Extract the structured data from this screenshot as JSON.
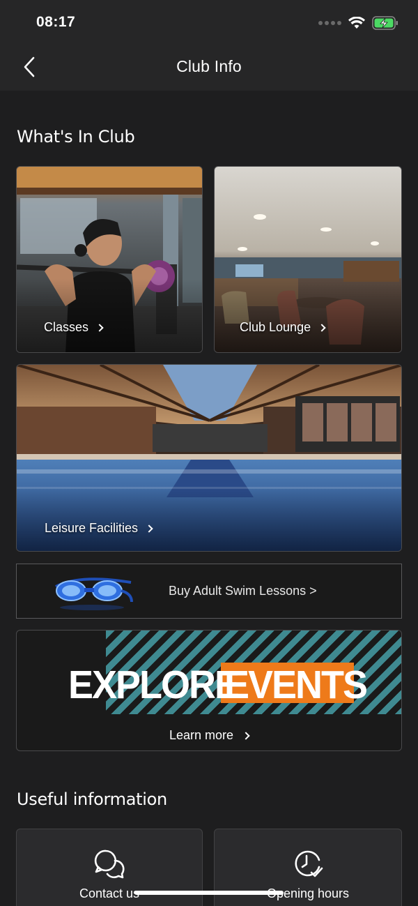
{
  "status_bar": {
    "time": "08:17"
  },
  "nav": {
    "title": "Club Info"
  },
  "whats_in_club": {
    "title": "What's In Club",
    "tiles": [
      {
        "label": "Classes"
      },
      {
        "label": "Club Lounge"
      },
      {
        "label": "Leisure Facilities"
      }
    ]
  },
  "swim_banner": {
    "label": "Buy Adult Swim Lessons >"
  },
  "events": {
    "word1": "EXPLORE",
    "word2": "EVENTS",
    "cta": "Learn more",
    "accent_color": "#ee7a1a",
    "stripe_color": "#3f8a91"
  },
  "useful_info": {
    "title": "Useful information",
    "cards": [
      {
        "label": "Contact us",
        "icon": "chat-bubbles-icon"
      },
      {
        "label": "Opening hours",
        "icon": "clock-check-icon"
      }
    ]
  }
}
